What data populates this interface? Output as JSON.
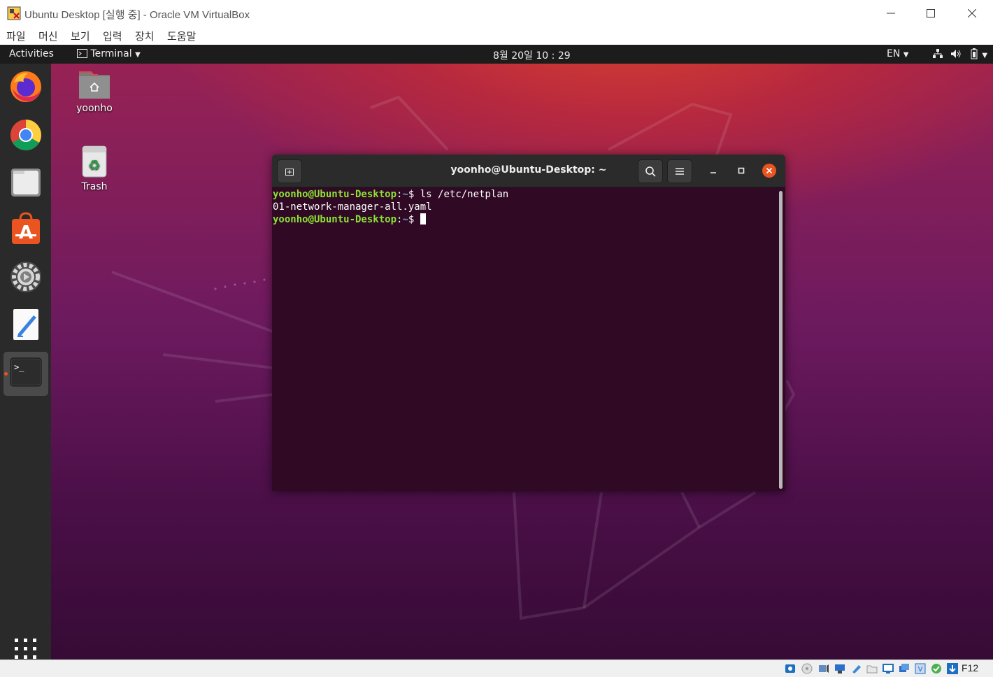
{
  "window": {
    "title": "Ubuntu Desktop [실행 중] - Oracle VM VirtualBox",
    "menu": [
      "파일",
      "머신",
      "보기",
      "입력",
      "장치",
      "도움말"
    ]
  },
  "topbar": {
    "activities": "Activities",
    "app_menu": "Terminal",
    "clock": "8월 20일  10 : 29",
    "lang": "EN"
  },
  "dock": {
    "apps": [
      "firefox-icon",
      "chrome-icon",
      "files-icon",
      "software-icon",
      "settings-icon",
      "text-editor-icon",
      "terminal-icon"
    ],
    "active": "terminal-icon"
  },
  "desktop_icons": [
    {
      "label": "yoonho",
      "icon": "home-folder-icon"
    },
    {
      "label": "Trash",
      "icon": "trash-icon"
    }
  ],
  "terminal": {
    "title": "yoonho@Ubuntu-Desktop: ~",
    "lines": [
      {
        "user": "yoonho@Ubuntu-Desktop",
        "path": "~",
        "command": "ls /etc/netplan"
      },
      {
        "output": "01-network-manager-all.yaml"
      },
      {
        "user": "yoonho@Ubuntu-Desktop",
        "path": "~",
        "command": ""
      }
    ]
  },
  "statusbar": {
    "host_key": "F12"
  },
  "colors": {
    "prompt_user": "#8ae234",
    "prompt_path": "#729fcf",
    "terminal_bg": "#300a24",
    "ubuntu_orange": "#e95420"
  }
}
